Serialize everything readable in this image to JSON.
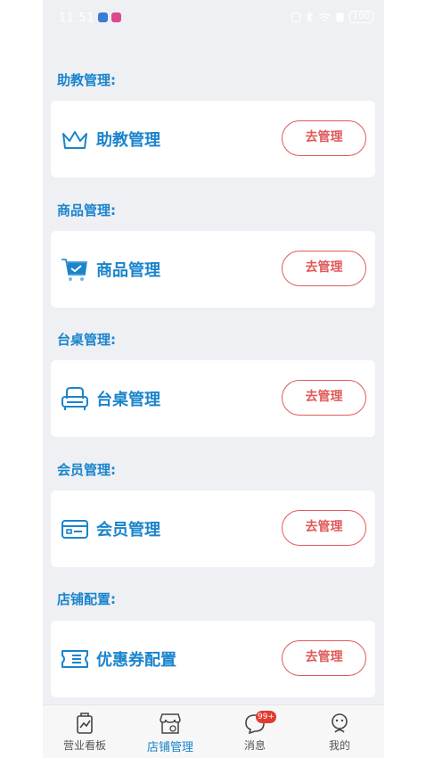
{
  "status_bar": {
    "time": "11:51",
    "battery": "100"
  },
  "sections": [
    {
      "title": "助教管理:",
      "label": "助教管理",
      "button": "去管理",
      "icon": "crown-icon"
    },
    {
      "title": "商品管理:",
      "label": "商品管理",
      "button": "去管理",
      "icon": "cart-icon"
    },
    {
      "title": "台桌管理:",
      "label": "台桌管理",
      "button": "去管理",
      "icon": "sofa-icon"
    },
    {
      "title": "会员管理:",
      "label": "会员管理",
      "button": "去管理",
      "icon": "member-card-icon"
    },
    {
      "title": "店铺配置:",
      "label": "优惠券配置",
      "button": "去管理",
      "icon": "coupon-icon"
    }
  ],
  "tabs": [
    {
      "label": "营业看板",
      "icon": "dashboard-icon",
      "active": false
    },
    {
      "label": "店铺管理",
      "icon": "store-icon",
      "active": true
    },
    {
      "label": "消息",
      "icon": "message-icon",
      "active": false,
      "badge": "99+"
    },
    {
      "label": "我的",
      "icon": "profile-icon",
      "active": false
    }
  ],
  "colors": {
    "accent": "#1a84cc",
    "button": "#e05a5a",
    "background": "#eef0f4"
  }
}
